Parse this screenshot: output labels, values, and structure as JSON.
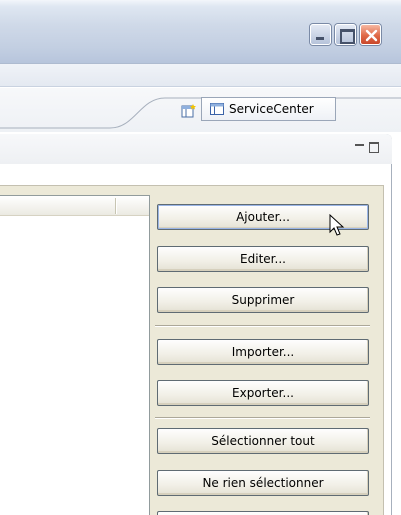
{
  "window": {
    "controls": [
      {
        "name": "minimize",
        "icon": "minimize-icon"
      },
      {
        "name": "maximize",
        "icon": "maximize-icon"
      },
      {
        "name": "close",
        "icon": "close-icon"
      }
    ]
  },
  "perspective_bar": {
    "open_perspective_icon": "open-perspective-icon",
    "active_perspective": {
      "label": "ServiceCenter",
      "icon": "perspective-icon"
    }
  },
  "view": {
    "controls": [
      {
        "name": "minimize-view",
        "icon": "view-minimize-icon"
      },
      {
        "name": "maximize-view",
        "icon": "view-maximize-icon"
      }
    ]
  },
  "actions": {
    "group1": [
      "Ajouter...",
      "Editer...",
      "Supprimer"
    ],
    "group2": [
      "Importer...",
      "Exporter..."
    ],
    "group3": [
      "Sélectionner tout",
      "Ne rien sélectionner"
    ]
  },
  "colors": {
    "close_button": "#e06a48",
    "panel_background": "#ece9d8",
    "button_border": "#5f6b73"
  }
}
